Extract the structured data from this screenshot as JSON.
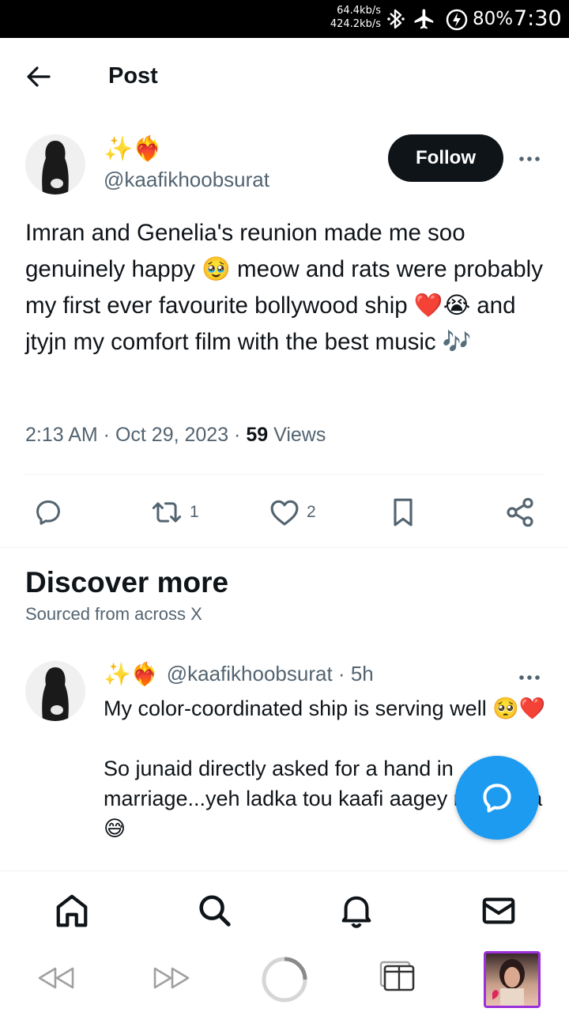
{
  "status_bar": {
    "speed_down": "64.4kb/s",
    "speed_up": "424.2kb/s",
    "battery": "80%",
    "time": "7:30",
    "icons": [
      "bluetooth-icon",
      "airplane-icon",
      "battery-saver-icon"
    ]
  },
  "header": {
    "title": "Post",
    "back_icon": "arrow-left-icon"
  },
  "tweet": {
    "display_name": "✨❤️‍🔥",
    "handle": "@kaafikhoobsurat",
    "follow_label": "Follow",
    "text": "Imran and Genelia's reunion made me soo genuinely happy 🥹 meow and rats were probably my first ever favourite bollywood ship ❤️😭 and jtyjn my comfort film with the best music 🎶",
    "time": "2:13 AM",
    "date": "Oct 29, 2023",
    "views_count": "59",
    "views_label": "Views",
    "retweets": "1",
    "likes": "2"
  },
  "discover": {
    "title": "Discover more",
    "subtitle": "Sourced from across X"
  },
  "sub_tweet": {
    "display_name": "✨❤️‍🔥",
    "handle": "@kaafikhoobsurat",
    "age": "5h",
    "line1": "My color-coordinated ship is serving well 🥺❤️",
    "line2": "So junaid directly asked for a hand in marriage...yeh ladka tou kaafi aagey nikal giya😅"
  },
  "colors": {
    "accent": "#1d9bf0",
    "text": "#0f1419",
    "muted": "#536471",
    "thumb_border": "#9b30d9"
  }
}
